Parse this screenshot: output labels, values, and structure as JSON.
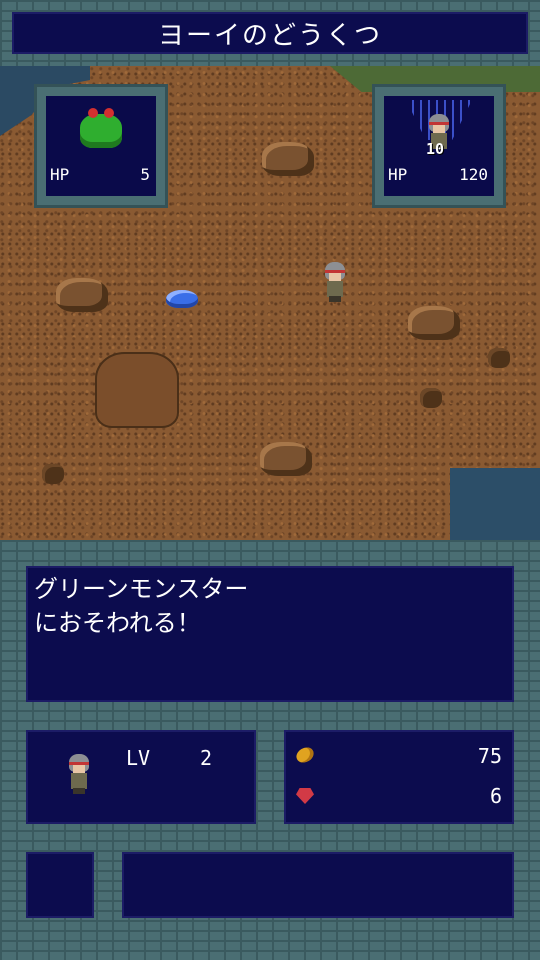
{
  "header": {
    "title": "ヨーイのどうくつ"
  },
  "enemy_card": {
    "hp_label": "HP",
    "hp_value": "5",
    "icon": "green-frog-monster-icon"
  },
  "player_card": {
    "hp_label": "HP",
    "hp_value": "120",
    "damage_popup": "10",
    "icon": "hero-portrait-icon"
  },
  "map": {
    "area": "cave-floor",
    "objects": [
      "rock",
      "rock",
      "rock",
      "rock",
      "rock",
      "small-rock",
      "small-rock",
      "small-rock",
      "pit",
      "blue-slime",
      "hero"
    ]
  },
  "message": {
    "text": "グリーンモンスター\nにおそわれる！"
  },
  "status": {
    "lv_label": "LV",
    "lv_value": "2",
    "portrait_icon": "hero-portrait-icon"
  },
  "resources": {
    "coin_icon": "gold-coin-icon",
    "coin_value": "75",
    "gem_icon": "red-gem-icon",
    "gem_value": "6"
  },
  "colors": {
    "panel": "#0c0c4e",
    "frame": "#4a6e73",
    "ground": "#8a5a32",
    "water": "#2b4a63",
    "text": "#ffffff"
  }
}
